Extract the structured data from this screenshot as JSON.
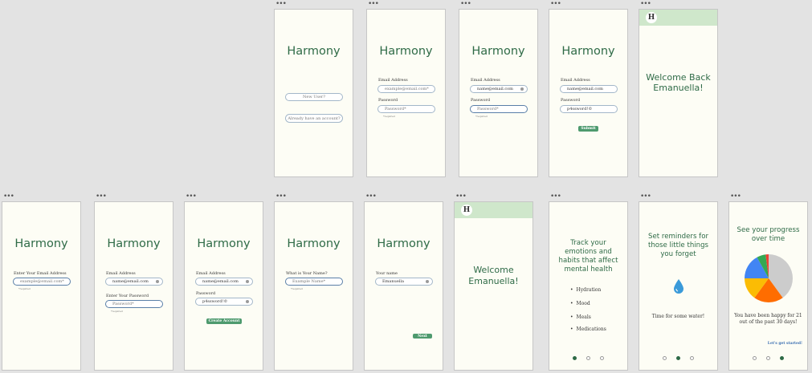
{
  "app": {
    "name": "Harmony",
    "logo_letter": "H"
  },
  "landing": {
    "new_user": "New User?",
    "have_account": "Already have an account?"
  },
  "login": {
    "email_label": "Email Address",
    "password_label": "Password",
    "email_placeholder": "example@email.com*",
    "password_placeholder": "Password*",
    "email_value": "name@email.com",
    "password_value": "p4ssword!©",
    "required": "*required",
    "submit": "Submit"
  },
  "welcome_back": {
    "line1": "Welcome Back",
    "line2": "Emanuella!"
  },
  "signup": {
    "enter_email": "Enter Your Email Address",
    "email_placeholder": "example@email.com*",
    "email_label": "Email Address",
    "email_value": "name@email.com",
    "enter_password": "Enter Your Password",
    "password_placeholder": "Password*",
    "password_label": "Password",
    "password_value": "p4ssword!©",
    "create_account": "Create Account",
    "name_question": "What is Your Name?",
    "name_placeholder": "Example Name*",
    "your_name": "Your name",
    "name_value": "Emanuella",
    "next": "Next",
    "required": "*required"
  },
  "welcome": {
    "line1": "Welcome",
    "line2": "Emanuella!"
  },
  "onboard1": {
    "title": "Track your emotions and habits that affect mental health",
    "items": [
      "Hydration",
      "Mood",
      "Meals",
      "Medications"
    ]
  },
  "onboard2": {
    "title": "Set reminders for those little things you forget",
    "message": "Time for some water!"
  },
  "onboard3": {
    "title": "See your progress over time",
    "message": "You have been happy for 21 out of the past 30 days!",
    "cta": "Let's get started!",
    "pie_slices": [
      {
        "value": 40,
        "color": "#cccccc"
      },
      {
        "value": 20,
        "color": "#ff6d00"
      },
      {
        "value": 15,
        "color": "#fbbc04"
      },
      {
        "value": 17,
        "color": "#4285f4"
      },
      {
        "value": 6,
        "color": "#34a853"
      },
      {
        "value": 2,
        "color": "#ea4335"
      }
    ]
  },
  "colors": {
    "brand_green": "#2f6b47",
    "button_green": "#4e9a6e",
    "header_green": "#cfe7cb",
    "link_blue": "#3b6fb2",
    "screen_bg": "#fdfdf5",
    "canvas_bg": "#e3e3e3"
  },
  "icons": {
    "frame_menu": "ellipsis-icon",
    "reminder": "water-drop-icon",
    "clear": "clear-field-icon"
  }
}
